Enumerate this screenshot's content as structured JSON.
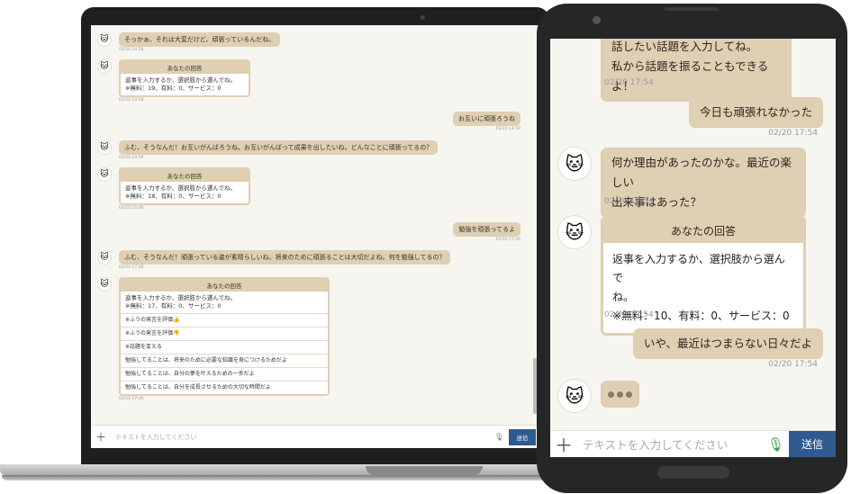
{
  "avatar_glyph": "🐱",
  "colors": {
    "bubble": "#dfcfb3",
    "send": "#2f5a8f",
    "background": "#f7f5ef",
    "mic": "#2e9a3f"
  },
  "laptop": {
    "messages": [
      {
        "text": "そっかぁ、それは大変だけど、頑張っているんだね。",
        "time": "02/20 14:58"
      },
      {
        "card_title": "あなたの回答",
        "card_body_1": "返事を入力するか、選択肢から選んでね。",
        "card_body_2": "※無料：19、有料：0、サービス：0",
        "time": "02/20 14:58"
      },
      {
        "text": "お互いに頑張ろうね",
        "time": "02/20 14:59"
      },
      {
        "text": "ふむ、そうなんだ！お互いがんばろうね。お互いがんばって成果を出したいね。どんなことに頑張ってるの？",
        "time": "02/20 14:59"
      },
      {
        "card_title": "あなたの回答",
        "card_body_1": "返事を入力するか、選択肢から選んでね。",
        "card_body_2": "※無料：18、有料：0、サービス：0",
        "time": "02/20 15:00"
      },
      {
        "text": "勉強を頑張ってるよ",
        "time": "02/20 17:46"
      },
      {
        "text": "ふむ、そうなんだ！頑張っている姿が素晴らしいね。将来のために頑張ることは大切だよね。何を勉強してるの？",
        "time": "02/20 17:46"
      },
      {
        "card_title": "あなたの回答",
        "card_body_1": "返事を入力するか、選択肢から選んでね。",
        "card_body_2": "※無料：17、有料：0、サービス：0",
        "time": "02/20 17:46"
      }
    ],
    "choices": [
      "※ふうの発言を評価👍",
      "※ふうの発言を評価👎",
      "※話題を変える",
      "勉強してることは、将来のために必要な知識を身につけるためだよ",
      "勉強してることは、自分の夢を叶えるための一歩だよ",
      "勉強してることは、自分を成長させるための大切な時間だよ"
    ],
    "input_placeholder": "テキストを入力してください",
    "send_label": "送信"
  },
  "phone": {
    "top_bubble_line1": "話したい話題を入力してね。",
    "top_bubble_line2": "私から話題を振ることもできるよ！",
    "top_time": "02/20 17:54",
    "user_msg_1": "今日も頑張れなかった",
    "user_time_1": "02/20 17:54",
    "bot_msg_line1": "何か理由があったのかな。最近の楽しい",
    "bot_msg_line2": "出来事はあった？",
    "bot_time": "02/20 17:54",
    "card_title": "あなたの回答",
    "card_body_1": "返事を入力するか、選択肢から選んで",
    "card_body_2": "ね。",
    "card_body_3": "※無料：10、有料：0、サービス：0",
    "card_time": "02/20 17:54",
    "user_msg_2": "いや、最近はつまらない日々だよ",
    "user_time_2": "02/20 17:54",
    "input_placeholder": "テキストを入力してください",
    "send_label": "送信"
  }
}
